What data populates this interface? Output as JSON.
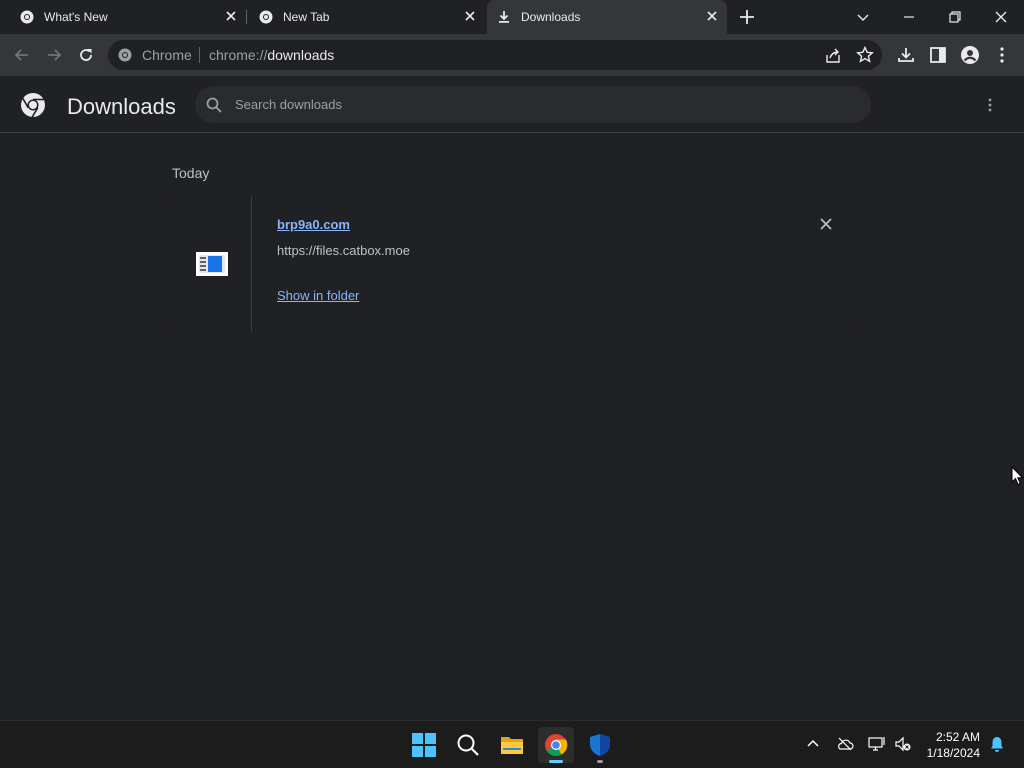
{
  "tabs": [
    {
      "title": "What's New",
      "active": false
    },
    {
      "title": "New Tab",
      "active": false
    },
    {
      "title": "Downloads",
      "active": true
    }
  ],
  "omnibox": {
    "site_label": "Chrome",
    "url_prefix": "chrome://",
    "url_host": "downloads"
  },
  "downloads_page": {
    "title": "Downloads",
    "search_placeholder": "Search downloads",
    "date_group": "Today",
    "items": [
      {
        "file_name": "brp9a0.com",
        "source_url": "https://files.catbox.moe",
        "action": "Show in folder"
      }
    ]
  },
  "taskbar": {
    "apps": [
      "start-icon",
      "search-icon",
      "file-explorer-icon",
      "chrome-icon",
      "windows-security-icon"
    ],
    "time": "2:52 AM",
    "date": "1/18/2024"
  },
  "colors": {
    "background": "#202124",
    "toolbar": "#35363a",
    "link": "#8ab4f8",
    "taskbar": "#1c1c1c"
  }
}
